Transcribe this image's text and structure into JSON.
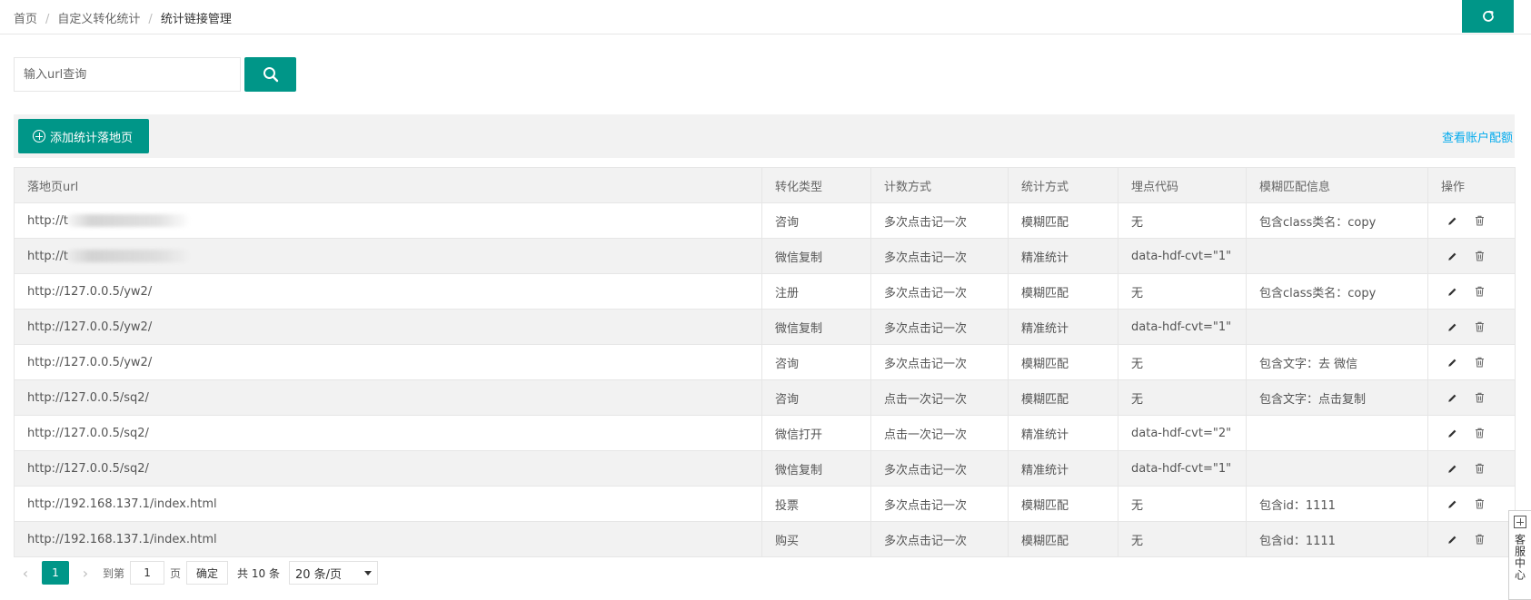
{
  "breadcrumb": {
    "items": [
      "首页",
      "自定义转化统计",
      "统计链接管理"
    ],
    "separator": "/"
  },
  "icons": {
    "refresh": "refresh-icon",
    "search": "search-icon",
    "add": "plus-circle-icon",
    "edit": "pencil-icon",
    "delete": "trash-icon",
    "service": "plus-square-icon"
  },
  "colors": {
    "accent": "#009688",
    "link": "#01AAED"
  },
  "search": {
    "placeholder": "输入url查询",
    "value": ""
  },
  "toolbar": {
    "add_label": "添加统计落地页",
    "quota_label": "查看账户配额"
  },
  "table": {
    "columns": [
      "落地页url",
      "转化类型",
      "计数方式",
      "统计方式",
      "埋点代码",
      "模糊匹配信息",
      "操作"
    ],
    "rows": [
      {
        "url": "http://t",
        "url_obscured": true,
        "type": "咨询",
        "count": "多次点击记一次",
        "method": "模糊匹配",
        "code": "无",
        "code_bold": false,
        "match": "包含class类名：copy"
      },
      {
        "url": "http://t",
        "url_obscured": true,
        "type": "微信复制",
        "count": "多次点击记一次",
        "method": "精准统计",
        "code": "data-hdf-cvt=\"1\"",
        "code_bold": true,
        "match": ""
      },
      {
        "url": "http://127.0.0.5/yw2/",
        "url_obscured": false,
        "type": "注册",
        "count": "多次点击记一次",
        "method": "模糊匹配",
        "code": "无",
        "code_bold": false,
        "match": "包含class类名：copy"
      },
      {
        "url": "http://127.0.0.5/yw2/",
        "url_obscured": false,
        "type": "微信复制",
        "count": "多次点击记一次",
        "method": "精准统计",
        "code": "data-hdf-cvt=\"1\"",
        "code_bold": true,
        "match": ""
      },
      {
        "url": "http://127.0.0.5/yw2/",
        "url_obscured": false,
        "type": "咨询",
        "count": "多次点击记一次",
        "method": "模糊匹配",
        "code": "无",
        "code_bold": false,
        "match": "包含文字：去 微信"
      },
      {
        "url": "http://127.0.0.5/sq2/",
        "url_obscured": false,
        "type": "咨询",
        "count": "点击一次记一次",
        "method": "模糊匹配",
        "code": "无",
        "code_bold": false,
        "match": "包含文字：点击复制"
      },
      {
        "url": "http://127.0.0.5/sq2/",
        "url_obscured": false,
        "type": "微信打开",
        "count": "点击一次记一次",
        "method": "精准统计",
        "code": "data-hdf-cvt=\"2\"",
        "code_bold": true,
        "match": ""
      },
      {
        "url": "http://127.0.0.5/sq2/",
        "url_obscured": false,
        "type": "微信复制",
        "count": "多次点击记一次",
        "method": "精准统计",
        "code": "data-hdf-cvt=\"1\"",
        "code_bold": true,
        "match": ""
      },
      {
        "url": "http://192.168.137.1/index.html",
        "url_obscured": false,
        "type": "投票",
        "count": "多次点击记一次",
        "method": "模糊匹配",
        "code": "无",
        "code_bold": false,
        "match": "包含id：1111"
      },
      {
        "url": "http://192.168.137.1/index.html",
        "url_obscured": false,
        "type": "购买",
        "count": "多次点击记一次",
        "method": "模糊匹配",
        "code": "无",
        "code_bold": false,
        "match": "包含id：1111"
      }
    ]
  },
  "pagination": {
    "prev": "‹",
    "next": "›",
    "current_page": "1",
    "goto_label": "到第",
    "goto_value": "1",
    "page_unit": "页",
    "confirm_label": "确定",
    "total_label": "共 10 条",
    "page_size": "20 条/页"
  },
  "service": {
    "label": "客服中心"
  }
}
